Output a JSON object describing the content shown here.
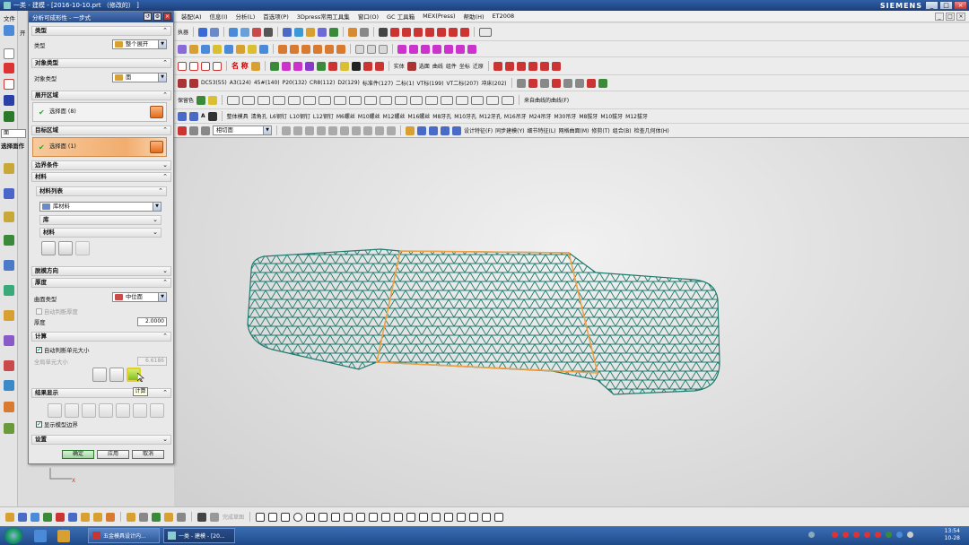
{
  "window": {
    "title": "一类 - 建模 - [2016-10-10.prt （修改的） ]",
    "brand": "SIEMENS",
    "controls": [
      "_",
      "□",
      "×"
    ]
  },
  "menubar": {
    "items": [
      "装配(A)",
      "信息(I)",
      "分析(L)",
      "首选项(P)",
      "3Dpress常用工具集",
      "窗口(O)",
      "GC 工具箱",
      "MEX(Press)",
      "帮助(H)",
      "ET2008"
    ]
  },
  "left_labels": {
    "file": "文件",
    "open": "开",
    "select_face": "选择面作",
    "face_field": "面",
    "toolbar_prefix": "执器"
  },
  "toolbar": {
    "row2_labels": [
      "名 称"
    ],
    "row3_labels": [
      "实体",
      "选面",
      "曲线",
      "组件",
      "坐标",
      "迁原"
    ],
    "row4_items": [
      "DC53(55)",
      "A3(124)",
      "45#(140)",
      "P20(132)",
      "CR8(112)",
      "D2(129)",
      "标准件(127)",
      "二标(1)",
      "VT标(199)",
      "VT二标(207)",
      "冲床(202)"
    ],
    "row5_prefix": "保留色",
    "row5_right": "来自曲线的曲线(F)",
    "row6_items": [
      "整体模具",
      "清角孔",
      "L6钢钉",
      "L10钢钉",
      "L12钢钉",
      "M6螺丝",
      "M10螺丝",
      "M12螺丝",
      "M16螺丝",
      "M8牙孔",
      "M10牙孔",
      "M12牙孔",
      "M16吊牙",
      "M24吊牙",
      "M30吊牙",
      "M8拔牙",
      "M10拔牙",
      "M12拔牙"
    ],
    "row7_filter": "相切面",
    "row7_menus": [
      "设计特征(F)",
      "同步建模(Y)",
      "细节特征(L)",
      "网格曲面(M)",
      "修剪(T)",
      "组合(B)",
      "检查几何体(H)"
    ]
  },
  "dialog": {
    "title": "分析可成形性 - 一步式",
    "sections": {
      "type": {
        "header": "类型",
        "label": "类型",
        "value": "整个展开"
      },
      "object_type": {
        "header": "对象类型",
        "label": "对象类型",
        "value": "面"
      },
      "unfold_region": {
        "header": "展开区域",
        "select_label": "选择面 (8)"
      },
      "target_region": {
        "header": "目标区域",
        "select_label": "选择面 (1)"
      },
      "boundary": {
        "header": "边界条件"
      },
      "material": {
        "header": "材料",
        "list_header": "材料列表",
        "list_value": "库材料",
        "library": "库",
        "material": "材料"
      },
      "demold": {
        "header": "脱模方向"
      },
      "thickness": {
        "header": "厚度",
        "surface_type_label": "曲面类型",
        "surface_type_value": "中位面",
        "auto_thickness": "自动判断厚度",
        "thickness_label": "厚度",
        "thickness_value": "2.0000"
      },
      "compute": {
        "header": "计算",
        "auto_element": "自动判断单元大小",
        "global_element": "全局单元大小",
        "global_value": "6.6186",
        "tooltip": "计算"
      },
      "results": {
        "header": "结果显示",
        "show_boundary": "显示模型边界"
      },
      "settings": {
        "header": "设置"
      }
    },
    "buttons": {
      "ok": "确定",
      "apply": "应用",
      "cancel": "取消"
    }
  },
  "bottombar": {
    "labels": [
      "完成草图"
    ]
  },
  "taskbar": {
    "tasks": [
      "五金模具设计内...",
      "一类 - 建模 - [20..."
    ],
    "time": "13:54",
    "date": "10-28"
  },
  "colors": {
    "mesh": "#1f7a6e",
    "boundary": "#f0a040",
    "active_selection": "#f2ad6e"
  }
}
